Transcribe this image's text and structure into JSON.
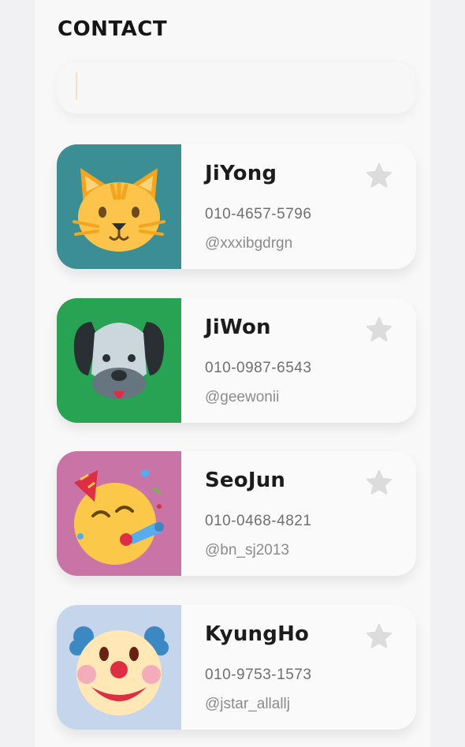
{
  "header": {
    "title": "CONTACT"
  },
  "search": {
    "value": "",
    "placeholder": ""
  },
  "contacts": [
    {
      "name": "JiYong",
      "phone": "010-4657-5796",
      "handle": "@xxxibgdrgn",
      "avatar_icon": "cat-face-icon",
      "bg_color": "#3b8e93"
    },
    {
      "name": "JiWon",
      "phone": "010-0987-6543",
      "handle": "@geewonii",
      "avatar_icon": "dog-face-icon",
      "bg_color": "#27a353"
    },
    {
      "name": "SeoJun",
      "phone": "010-0468-4821",
      "handle": "@bn_sj2013",
      "avatar_icon": "party-face-icon",
      "bg_color": "#c874a6"
    },
    {
      "name": "KyungHo",
      "phone": "010-9753-1573",
      "handle": "@jstar_allallj",
      "avatar_icon": "clown-face-icon",
      "bg_color": "#c5d5ec"
    }
  ],
  "colors": {
    "star": "#dcdcdc",
    "text": "#1c1c1c"
  }
}
